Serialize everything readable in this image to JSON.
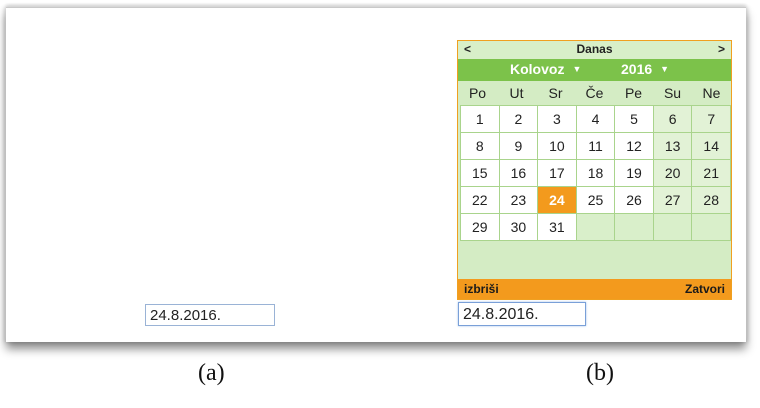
{
  "panel_a": {
    "date_value": "24.8.2016.",
    "caption": "(a)"
  },
  "panel_b": {
    "date_value": "24.8.2016.",
    "caption": "(b)",
    "calendar": {
      "prev_label": "<",
      "today_label": "Danas",
      "next_label": ">",
      "month_label": "Kolovoz",
      "year_label": "2016",
      "dropdown_caret": "▼",
      "weekdays": [
        "Po",
        "Ut",
        "Sr",
        "Če",
        "Pe",
        "Su",
        "Ne"
      ],
      "weeks": [
        [
          "1",
          "2",
          "3",
          "4",
          "5",
          "6",
          "7"
        ],
        [
          "8",
          "9",
          "10",
          "11",
          "12",
          "13",
          "14"
        ],
        [
          "15",
          "16",
          "17",
          "18",
          "19",
          "20",
          "21"
        ],
        [
          "22",
          "23",
          "24",
          "25",
          "26",
          "27",
          "28"
        ],
        [
          "29",
          "30",
          "31",
          "",
          "",
          "",
          ""
        ]
      ],
      "selected_day": "24",
      "clear_label": "izbriši",
      "close_label": "Zatvori"
    }
  },
  "colors": {
    "header_green": "#7cc24a",
    "calendar_bg": "#d4ecc4",
    "accent_orange": "#f39a1d",
    "input_border": "#9ab3d6"
  }
}
